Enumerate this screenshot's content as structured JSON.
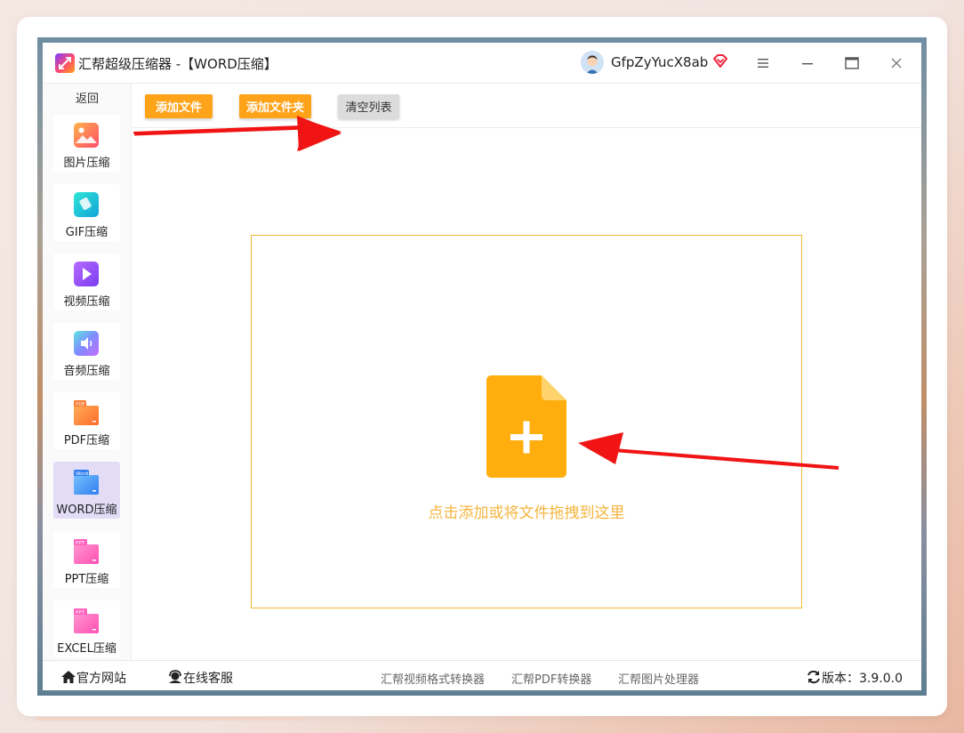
{
  "window": {
    "title": "汇帮超级压缩器  -【WORD压缩】",
    "username": "GfpZyYucX8ab"
  },
  "sidebar": {
    "back_label": "返回",
    "items": [
      {
        "label": "图片压缩",
        "icon": "image-icon"
      },
      {
        "label": "GIF压缩",
        "icon": "gif-icon"
      },
      {
        "label": "视频压缩",
        "icon": "video-icon"
      },
      {
        "label": "音频压缩",
        "icon": "audio-icon"
      },
      {
        "label": "PDF压缩",
        "icon": "pdf-icon",
        "badge": "PDF"
      },
      {
        "label": "WORD压缩",
        "icon": "word-icon",
        "badge": "Word",
        "active": true
      },
      {
        "label": "PPT压缩",
        "icon": "ppt-icon",
        "badge": "PPT"
      },
      {
        "label": "EXCEL压缩",
        "icon": "excel-icon",
        "badge": "PPT"
      }
    ]
  },
  "toolbar": {
    "add_file": "添加文件",
    "add_folder": "添加文件夹",
    "clear_list": "清空列表"
  },
  "dropzone": {
    "hint": "点击添加或将文件拖拽到这里"
  },
  "statusbar": {
    "website": "官方网站",
    "support": "在线客服",
    "links": [
      "汇帮视频格式转换器",
      "汇帮PDF转换器",
      "汇帮图片处理器"
    ],
    "version_label": "版本：",
    "version": "3.9.0.0"
  },
  "colors": {
    "accent_orange": "#ffa31a",
    "drop_text": "#f5b53f",
    "active_item": "#e2dcf7",
    "annotation_arrow": "#f01414"
  }
}
